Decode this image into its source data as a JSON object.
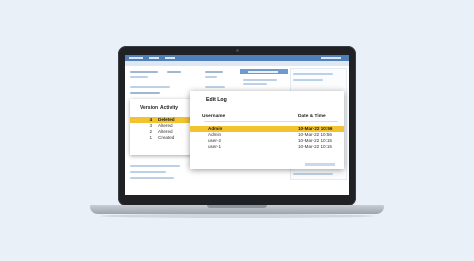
{
  "versions": {
    "headers": {
      "version": "Version",
      "activity": "Activity"
    },
    "rows": [
      {
        "version": "4",
        "activity": "Deleted",
        "selected": true
      },
      {
        "version": "3",
        "activity": "Altered",
        "selected": false
      },
      {
        "version": "2",
        "activity": "Altered",
        "selected": false
      },
      {
        "version": "1",
        "activity": "Created",
        "selected": false
      }
    ]
  },
  "edit_log": {
    "title": "Edit Log",
    "headers": {
      "username": "Username",
      "datetime": "Date & Time"
    },
    "rows": [
      {
        "username": "Admin",
        "datetime": "10-Mar-22 10:56",
        "selected": true
      },
      {
        "username": "Admin",
        "datetime": "10-Mar-22 10:56",
        "selected": false
      },
      {
        "username": "user-2",
        "datetime": "10-Mar-22 10:15",
        "selected": false
      },
      {
        "username": "user-1",
        "datetime": "10-Mar-22 10:15",
        "selected": false
      }
    ]
  },
  "colors": {
    "background": "#e9f0f7",
    "highlight": "#f2c230",
    "app_header": "#4f7fb8"
  }
}
